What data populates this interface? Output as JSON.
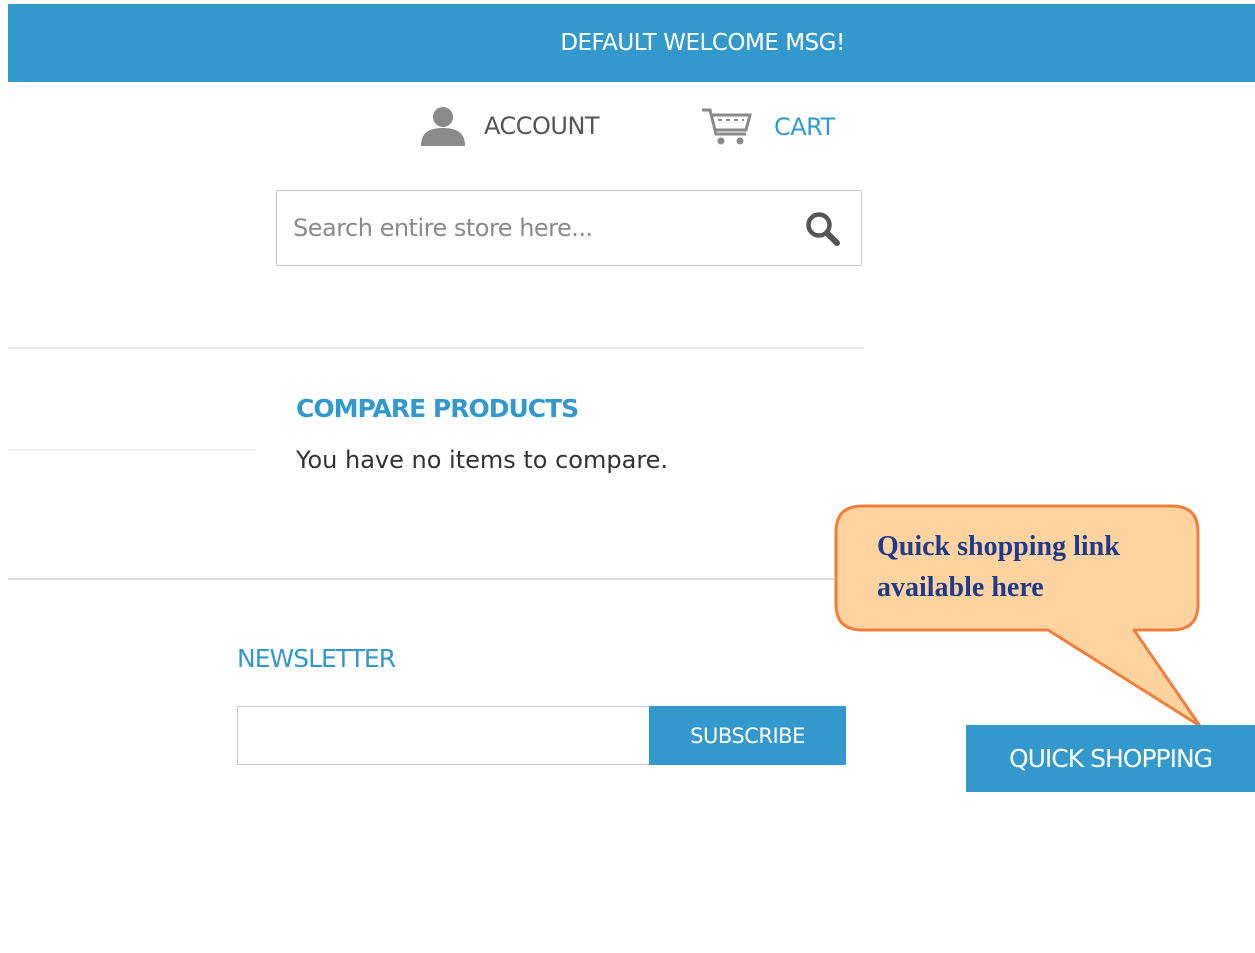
{
  "topbar": {
    "welcome": "DEFAULT WELCOME MSG!"
  },
  "header": {
    "account_label": "ACCOUNT",
    "cart_label": "CART"
  },
  "search": {
    "placeholder": "Search entire store here..."
  },
  "compare": {
    "title": "COMPARE PRODUCTS",
    "empty_text": "You have no items to compare."
  },
  "newsletter": {
    "title": "NEWSLETTER",
    "subscribe_label": "SUBSCRIBE"
  },
  "quick_shopping": {
    "label": "QUICK SHOPPING"
  },
  "callout": {
    "line1": "Quick shopping link",
    "line2": "available here"
  },
  "icons": {
    "account": "user-icon",
    "cart": "cart-icon",
    "search": "search-icon"
  },
  "colors": {
    "accent": "#3399cc",
    "callout_fill": "#ffd3a0",
    "callout_border": "#f07f3c",
    "callout_text": "#1f3b8a"
  }
}
